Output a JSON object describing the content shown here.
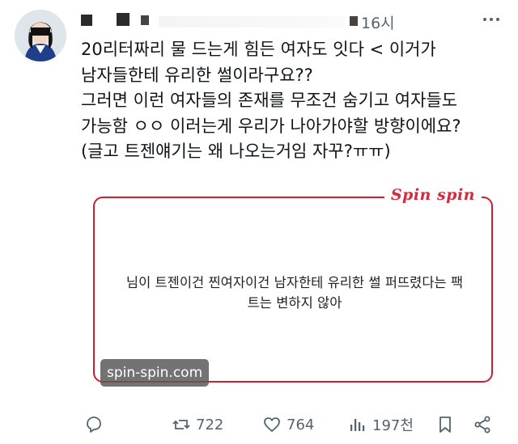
{
  "post": {
    "timestamp": "16시",
    "text": "20리터짜리 물 드는게 힘든 여자도 잇다 < 이거가\n남자들한테 유리한 썰이라구요??\n그러면 이런 여자들의 존재를 무조건 숨기고 여자들도\n가능함 ㅇㅇ 이러는게 우리가 나아가야할 방향이에요?\n(글고 트젠얘기는 왜 나오는거임 자꾸?ㅠㅠ)"
  },
  "card": {
    "logo": "Spin spin",
    "quote": "님이 트젠이건 찐여자이건 남자한테 유리한 썰 퍼뜨렸다는 팩\n트는 변하지 않아",
    "source": "spin-spin.com"
  },
  "actions": {
    "retweets": "722",
    "likes": "764",
    "views": "197천"
  },
  "colors": {
    "accent_red": "#c8202f",
    "icon_gray": "#536471"
  },
  "icons": [
    "avatar",
    "more-icon",
    "reply-icon",
    "retweet-icon",
    "like-icon",
    "views-icon",
    "bookmark-icon",
    "share-icon"
  ]
}
